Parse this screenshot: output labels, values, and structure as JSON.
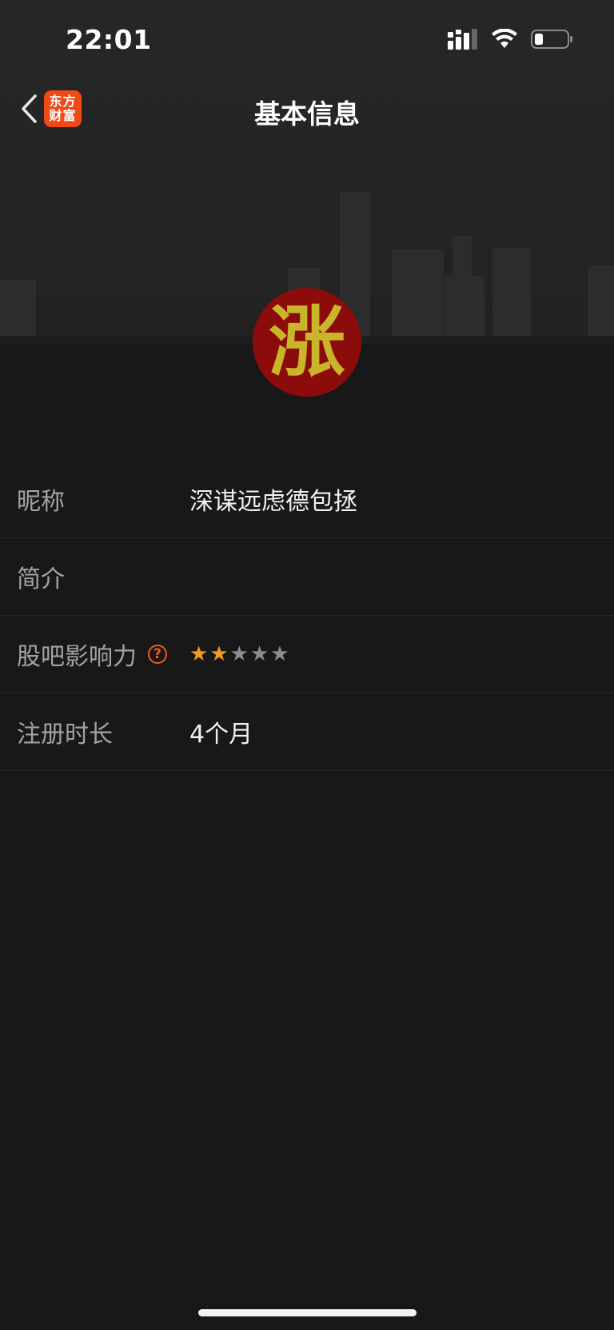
{
  "status_bar": {
    "time": "22:01",
    "icons": [
      "cellular-signal-icon",
      "wifi-icon",
      "battery-icon"
    ],
    "battery_level": 0.2
  },
  "nav": {
    "back_icon": "chevron-left-icon",
    "logo_line1": "东方",
    "logo_line2": "财富",
    "title": "基本信息"
  },
  "profile": {
    "avatar_char": "涨",
    "avatar_bg": "#8c0b0b",
    "avatar_fg": "#c9b52a"
  },
  "info": {
    "rows": [
      {
        "label": "昵称",
        "value": "深谋远虑德包拯"
      },
      {
        "label": "简介",
        "value": ""
      },
      {
        "label": "股吧影响力",
        "help_icon": "question-circle-icon",
        "rating": 2,
        "rating_max": 5
      },
      {
        "label": "注册时长",
        "value": "4个月"
      }
    ]
  },
  "colors": {
    "accent": "#f04a16",
    "star_filled": "#f39a1c",
    "star_empty": "#8d8d8d",
    "background": "#181818"
  }
}
